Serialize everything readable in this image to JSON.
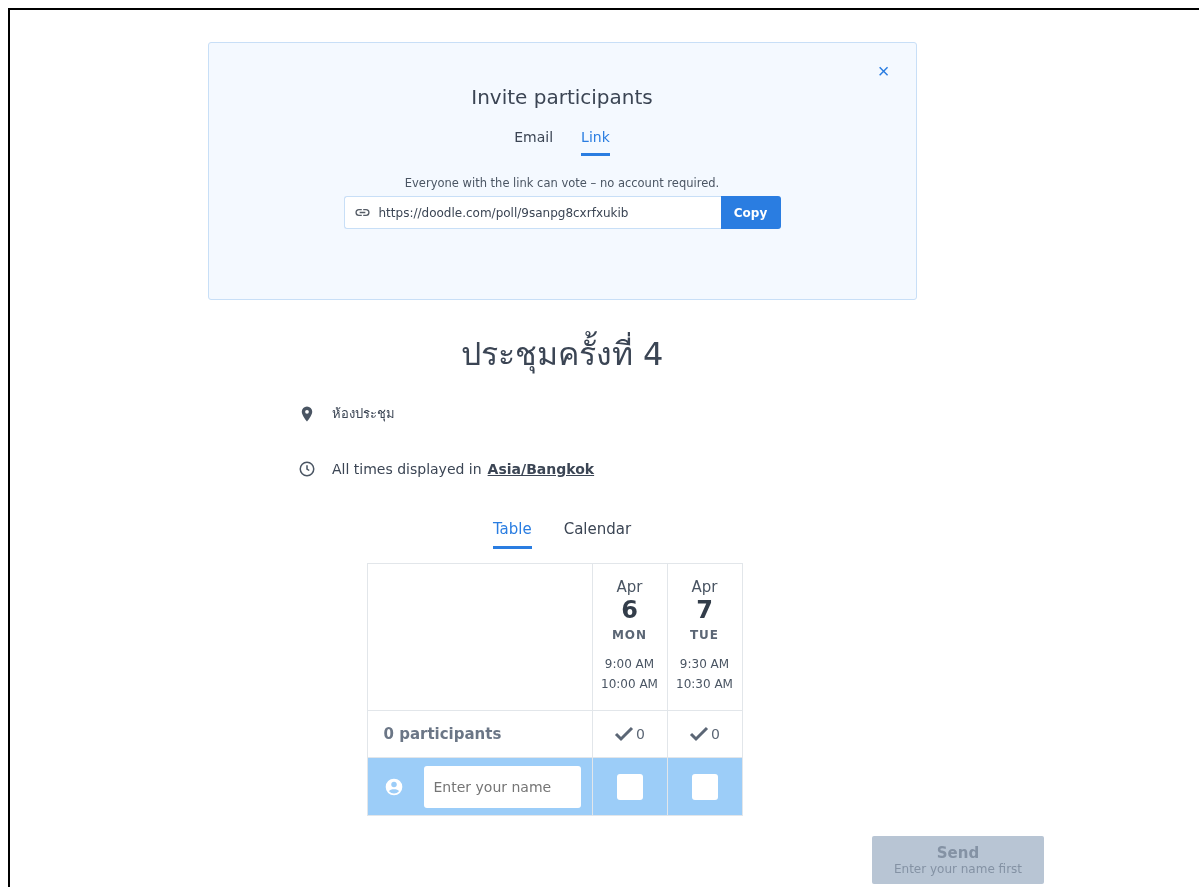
{
  "invite_dialog": {
    "title": "Invite participants",
    "close": "×",
    "tabs": [
      {
        "label": "Email",
        "selected": false
      },
      {
        "label": "Link",
        "selected": true
      }
    ],
    "hint": "Everyone with the link can vote – no account required.",
    "link": "https://doodle.com/poll/9sanpg8cxrfxukib",
    "copy_button": "Copy"
  },
  "poll": {
    "title": "ประชุมครั้งที่ 4",
    "location": "ห้องประชุม",
    "timezone_prefix": "All times displayed in",
    "timezone": "Asia/Bangkok"
  },
  "view_tabs": [
    {
      "label": "Table",
      "selected": true
    },
    {
      "label": "Calendar",
      "selected": false
    }
  ],
  "table": {
    "columns": [
      {
        "month": "Apr",
        "day": "6",
        "weekday": "MON",
        "start": "9:00 AM",
        "end": "10:00 AM",
        "count": "0",
        "checked": false
      },
      {
        "month": "Apr",
        "day": "7",
        "weekday": "TUE",
        "start": "9:30 AM",
        "end": "10:30 AM",
        "count": "0",
        "checked": false
      }
    ],
    "participants": "0 participants",
    "name_placeholder": "Enter your name"
  },
  "send_button": {
    "label": "Send",
    "sublabel": "Enter your name first",
    "disabled": true
  }
}
